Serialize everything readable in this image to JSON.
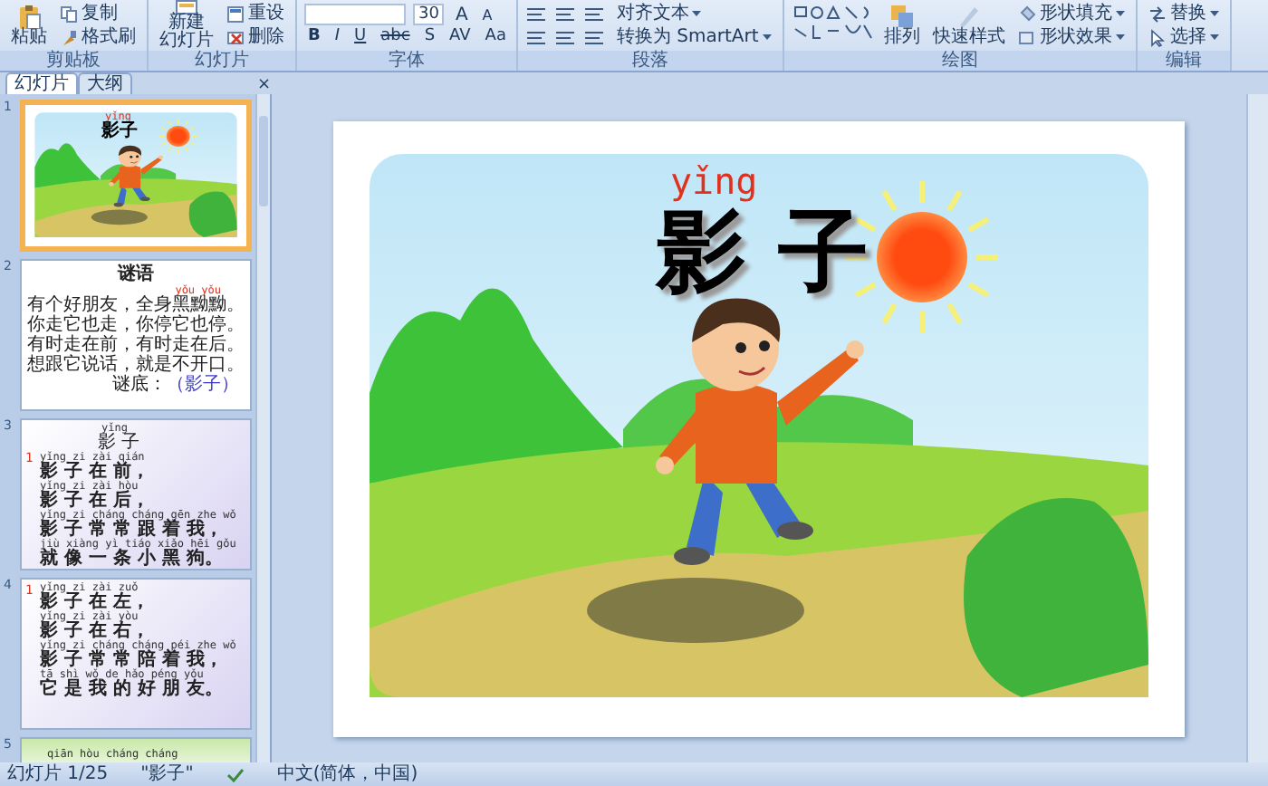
{
  "ribbon": {
    "groups": [
      {
        "kind": "clipboard",
        "label": "剪贴板",
        "paste": "粘贴",
        "copy": "复制",
        "format_painter": "格式刷"
      },
      {
        "kind": "slides",
        "label": "幻灯片",
        "new_slide": [
          "新建",
          "幻灯片"
        ],
        "reset": "重设",
        "delete": "删除"
      },
      {
        "kind": "font",
        "label": "字体",
        "size": "30",
        "grow_shrink": [
          "A",
          "A"
        ],
        "format_buttons": [
          "B",
          "I",
          "U",
          "abc",
          "S",
          "AV",
          "Aa"
        ]
      },
      {
        "kind": "paragraph",
        "label": "段落",
        "align_text": "对齐文本",
        "smartart": "转换为 SmartArt"
      },
      {
        "kind": "drawing",
        "label": "绘图",
        "arrange": "排列",
        "quick_styles": "快速样式",
        "shape_fill": "形状填充",
        "shape_effects": "形状效果"
      },
      {
        "kind": "editing",
        "label": "编辑",
        "replace": "替换",
        "select": "选择"
      }
    ]
  },
  "pane": {
    "tabs": [
      {
        "label": "幻灯片",
        "selected": true
      },
      {
        "label": "大纲",
        "selected": false
      }
    ],
    "close": "×"
  },
  "slides": [
    {
      "number": "1",
      "selected": true,
      "kind": "title",
      "pinyin": "yǐng",
      "title": "影子"
    },
    {
      "number": "2",
      "selected": false,
      "kind": "riddle",
      "heading": "谜语",
      "lines": [
        {
          "text": "有个好朋友，全身黑黝黝。",
          "pinyin": "yǒu yǒu"
        },
        {
          "text": "你走它也走，你停它也停。"
        },
        {
          "text": "有时走在前，有时走在后。"
        },
        {
          "text": "想跟它说话，就是不开口。"
        }
      ],
      "answer_label": "谜底：",
      "answer": "（影子）"
    },
    {
      "number": "3",
      "selected": false,
      "kind": "poem",
      "marker": "1",
      "header_pinyin": "yǐng",
      "header": "影 子",
      "lines": [
        {
          "pinyin": "yǐng zi zài qián",
          "text": "影 子 在 前，"
        },
        {
          "pinyin": "yǐng zi zài hòu",
          "text": "影 子 在 后，"
        },
        {
          "pinyin": "yǐng zi cháng cháng gēn zhe wǒ",
          "text": "影 子 常 常 跟 着 我，"
        },
        {
          "pinyin": "jiù xiàng yì tiáo xiǎo hēi gǒu",
          "text": "就 像 一 条 小 黑 狗。"
        }
      ]
    },
    {
      "number": "4",
      "selected": false,
      "kind": "poem",
      "marker": "1",
      "lines": [
        {
          "pinyin": "yǐng zi zài zuǒ",
          "text": "影 子 在 左，"
        },
        {
          "pinyin": "yǐng zi zài yòu",
          "text": "影 子 在 右，"
        },
        {
          "pinyin": "yǐng zi cháng cháng péi zhe wǒ",
          "text": "影 子 常 常 陪 着 我，"
        },
        {
          "pinyin": "tā shì wǒ de hǎo péng yǒu",
          "text": "它 是 我 的 好 朋 友。"
        }
      ]
    },
    {
      "number": "5",
      "selected": false,
      "kind": "partial",
      "lines": [
        {
          "pinyin": "qiān hòu cháng cháng"
        }
      ]
    }
  ],
  "main_slide": {
    "pinyin": "yǐng",
    "title": "影 子"
  },
  "status_bar": [
    "幻灯片 1/25",
    "\"影子\"",
    "中文(简体，中国)"
  ]
}
